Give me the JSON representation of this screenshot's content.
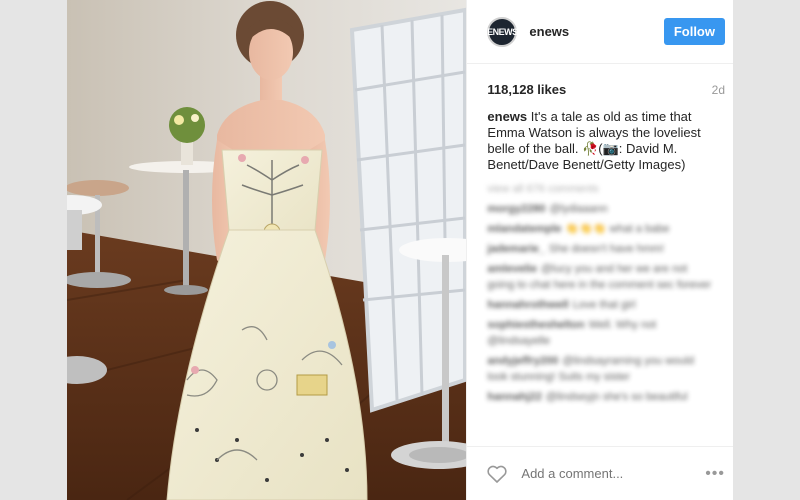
{
  "post": {
    "account": {
      "username": "enews",
      "avatar_text": "ENEWS",
      "follow_label": "Follow"
    },
    "likes": "118,128 likes",
    "age": "2d",
    "caption": {
      "username": "enews",
      "text": "It's a tale as old as time that Emma Watson is always the loveliest belle of the ball. 🥀(📷: David M. Benett/Dave Benett/Getty Images)"
    },
    "comments": [
      {
        "user": "",
        "text": "view all 676 comments"
      },
      {
        "user": "morgy2280",
        "text": "@lydiaaann"
      },
      {
        "user": "mlandatemple",
        "text": "👏👏👏 what a babe"
      },
      {
        "user": "jademarie_",
        "text": "She doesn't have hmm!"
      },
      {
        "user": "amlevelie",
        "text": "@lucy you and her we are not going to chat here in the comment sec forever"
      },
      {
        "user": "hannahrothwell",
        "text": "Love that girl"
      },
      {
        "user": "sophiestheshelton",
        "text": "Well. Why not @lindsayelle"
      },
      {
        "user": "andyjeffry200",
        "text": "@lindsayraming you would look stunning! Suits my sister"
      },
      {
        "user": "hannahj22",
        "text": "@lindseyjn she's so beautiful"
      }
    ],
    "add_comment_placeholder": "Add a comment...",
    "more_options": "•••"
  },
  "colors": {
    "follow_button": "#3897f0",
    "text": "#262626",
    "muted": "#999999",
    "backdrop": "#e5e5e5"
  },
  "icons": {
    "like": "heart-outline-icon",
    "more": "ellipsis-icon"
  }
}
